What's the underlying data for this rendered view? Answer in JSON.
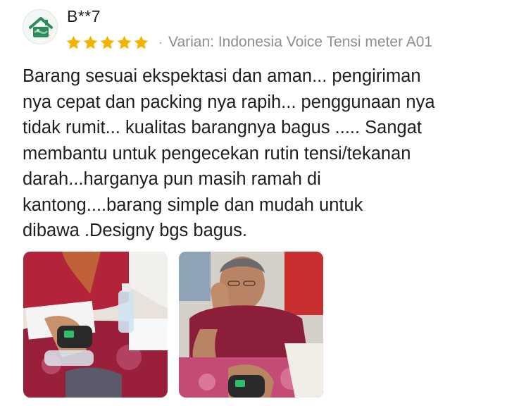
{
  "review": {
    "username": "B**7",
    "rating": 5,
    "rating_max": 5,
    "star_color": "#f5b400",
    "separator": "·",
    "variant_text": "Varian: Indonesia Voice Tensi meter A01",
    "text_lines": [
      "Barang sesuai ekspektasi dan aman... pengiriman",
      "nya cepat dan packing nya rapih... penggunaan nya",
      "tidak rumit... kualitas barangnya bagus ..... Sangat",
      "membantu untuk pengecekan rutin tensi/tekanan",
      "darah...harganya pun masih ramah di",
      "kantong....barang simple dan mudah untuk",
      "dibawa .Designy bgs bagus."
    ],
    "photos": [
      {
        "subject": "hands-with-wrist-blood-pressure-monitor"
      },
      {
        "subject": "woman-using-wrist-blood-pressure-monitor"
      }
    ]
  },
  "colors": {
    "avatar_green": "#2e8a5a",
    "variant_gray": "#8e8e8e",
    "text": "#1e1e1e"
  }
}
